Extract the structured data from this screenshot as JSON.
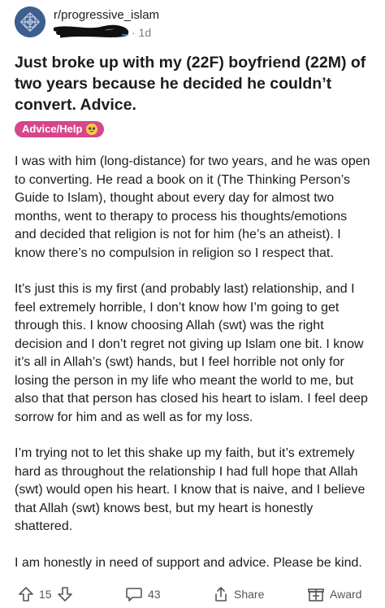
{
  "post": {
    "subreddit": "r/progressive_islam",
    "age": "· 1d",
    "title": "Just broke up with my (22F) boyfriend (22M) of two years because he decided he couldn’t convert. Advice.",
    "flair": "Advice/Help",
    "paragraphs": [
      "I was with him (long-distance) for two years, and he was open to converting. He read a book on it (The Thinking Person’s Guide to Islam), thought about every day for almost two months, went to therapy to process his thoughts/emotions and decided that religion is not for him (he’s an atheist). I know there’s no compulsion in religion so I respect that.",
      "It’s just this is my first (and probably last) relationship, and I feel extremely horrible, I don’t know how I’m going to get through this. I know choosing Allah (swt) was the right decision and I don’t regret not giving up Islam one bit. I know it’s all in Allah’s (swt) hands, but I feel horrible not only for losing the person in my life who meant the world to me, but also that that person has closed his heart to islam. I feel deep sorrow for him and as well as for my loss.",
      "I’m trying not to let this shake up my faith, but it’s extremely hard as throughout the relationship I had full hope that Allah (swt) would open his heart. I know that is naive, and I believe that Allah (swt) knows best, but my heart is honestly shattered.",
      "I am honestly in need of support and advice. Please be kind."
    ]
  },
  "actions": {
    "votes": "15",
    "comments": "43",
    "share_label": "Share",
    "award_label": "Award"
  },
  "colors": {
    "flair_bg": "#d7468a",
    "avatar_bg": "#3d5f8f",
    "text": "#1c1c1c",
    "muted": "#7c7c7c"
  },
  "icons": [
    "upvote-icon",
    "downvote-icon",
    "comment-icon",
    "share-icon",
    "award-icon",
    "subreddit-avatar"
  ]
}
